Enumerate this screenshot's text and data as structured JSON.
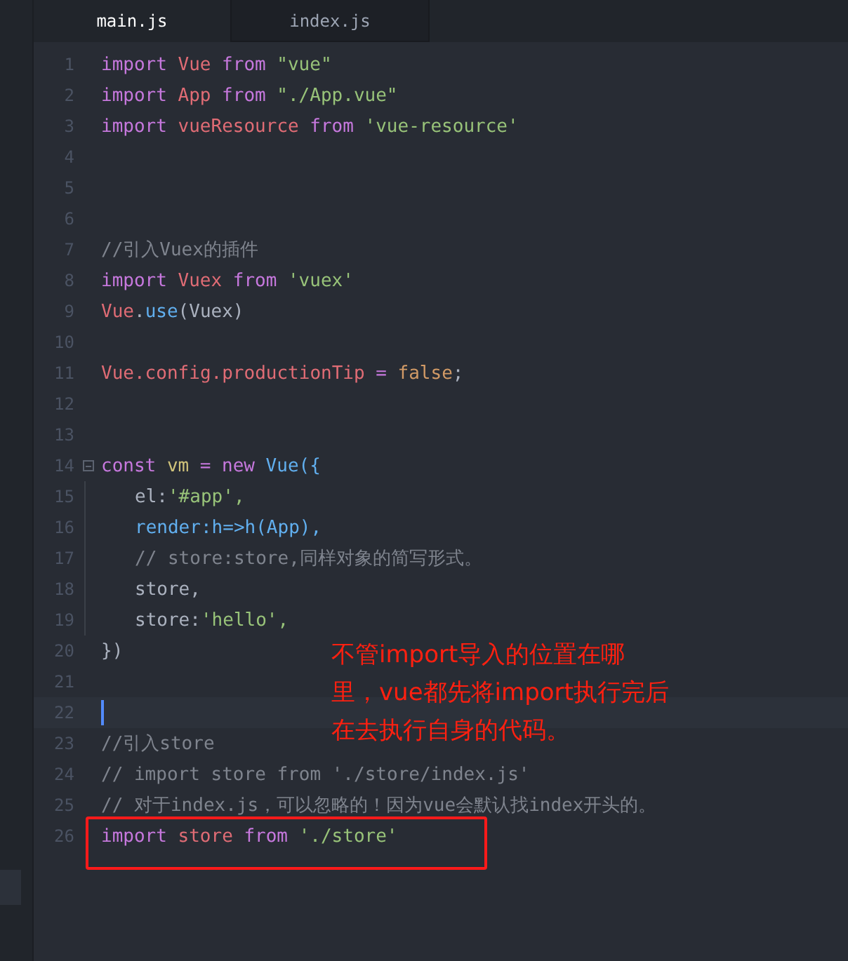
{
  "tabs": [
    {
      "label": "main.js",
      "selected": true
    },
    {
      "label": "index.js",
      "selected": false
    }
  ],
  "lines": [
    {
      "number": "1",
      "tokens": [
        {
          "kind": "keyword",
          "text": "import"
        },
        {
          "kind": "ident",
          "text": "Vue"
        },
        {
          "kind": "keyword",
          "text": "from"
        },
        {
          "kind": "string",
          "text": "\"vue\""
        }
      ]
    },
    {
      "number": "2",
      "tokens": [
        {
          "kind": "keyword",
          "text": "import"
        },
        {
          "kind": "ident",
          "text": "App"
        },
        {
          "kind": "keyword",
          "text": "from"
        },
        {
          "kind": "string",
          "text": "\"./App.vue\""
        }
      ]
    },
    {
      "number": "3",
      "tokens": [
        {
          "kind": "keyword",
          "text": "import"
        },
        {
          "kind": "ident",
          "text": "vueResource"
        },
        {
          "kind": "keyword",
          "text": "from"
        },
        {
          "kind": "string",
          "text": "'vue-resource'"
        }
      ]
    },
    {
      "number": "4"
    },
    {
      "number": "5"
    },
    {
      "number": "6"
    },
    {
      "number": "7",
      "tokens": [
        {
          "kind": "comment",
          "text": "//引入Vuex的插件"
        }
      ]
    },
    {
      "number": "8",
      "tokens": [
        {
          "kind": "keyword",
          "text": "import"
        },
        {
          "kind": "ident",
          "text": "Vuex"
        },
        {
          "kind": "keyword",
          "text": "from"
        },
        {
          "kind": "string",
          "text": "'vuex'"
        }
      ]
    },
    {
      "number": "9",
      "tokens": [
        {
          "kind": "ident",
          "text": "Vue"
        },
        {
          "kind": "punct",
          "text": ".",
          "join": true
        },
        {
          "kind": "func",
          "text": "use",
          "join": true
        },
        {
          "kind": "punct",
          "text": "(Vuex)",
          "join": true
        }
      ]
    },
    {
      "number": "10"
    },
    {
      "number": "11",
      "tokens": [
        {
          "kind": "ident",
          "text": "Vue.config.productionTip"
        },
        {
          "kind": "operator",
          "text": "="
        },
        {
          "kind": "literal",
          "text": "false"
        },
        {
          "kind": "punct",
          "text": ";",
          "join": true
        }
      ]
    },
    {
      "number": "12"
    },
    {
      "number": "13"
    },
    {
      "number": "14",
      "fold": true,
      "tokens": [
        {
          "kind": "keyword",
          "text": "const"
        },
        {
          "kind": "variable",
          "text": "vm"
        },
        {
          "kind": "operator",
          "text": "="
        },
        {
          "kind": "keyword",
          "text": "new"
        },
        {
          "kind": "func",
          "text": "Vue({"
        }
      ]
    },
    {
      "number": "15",
      "indented": true,
      "tokens": [
        {
          "kind": "punct",
          "text": "el:"
        },
        {
          "kind": "string",
          "text": "'#app',",
          "join": true
        }
      ]
    },
    {
      "number": "16",
      "indented": true,
      "tokens": [
        {
          "kind": "func",
          "text": "render:h=>h(App),"
        }
      ]
    },
    {
      "number": "17",
      "indented": true,
      "tokens": [
        {
          "kind": "comment",
          "text": "// store:store,同样对象的简写形式。"
        }
      ]
    },
    {
      "number": "18",
      "indented": true,
      "tokens": [
        {
          "kind": "punct",
          "text": "store,"
        }
      ]
    },
    {
      "number": "19",
      "indented": true,
      "tokens": [
        {
          "kind": "punct",
          "text": "store:"
        },
        {
          "kind": "string",
          "text": "'hello',",
          "join": true
        }
      ]
    },
    {
      "number": "20",
      "tokens": [
        {
          "kind": "punct",
          "text": "})"
        }
      ]
    },
    {
      "number": "21"
    },
    {
      "number": "22",
      "current": true
    },
    {
      "number": "23",
      "tokens": [
        {
          "kind": "comment",
          "text": "//引入store"
        }
      ]
    },
    {
      "number": "24",
      "tokens": [
        {
          "kind": "comment",
          "text": "// import store from './store/index.js'"
        }
      ]
    },
    {
      "number": "25",
      "tokens": [
        {
          "kind": "comment",
          "text": "// 对于index.js，可以忽略的！因为vue会默认找index开头的。"
        }
      ]
    },
    {
      "number": "26",
      "boxed": true,
      "tokens": [
        {
          "kind": "keyword",
          "text": "import"
        },
        {
          "kind": "ident",
          "text": "store"
        },
        {
          "kind": "keyword",
          "text": "from"
        },
        {
          "kind": "string",
          "text": "'./store'"
        }
      ]
    }
  ],
  "annotation": [
    "不管import导入的位置在哪",
    "里，vue都先将import执行完后",
    "在去执行自身的代码。"
  ]
}
